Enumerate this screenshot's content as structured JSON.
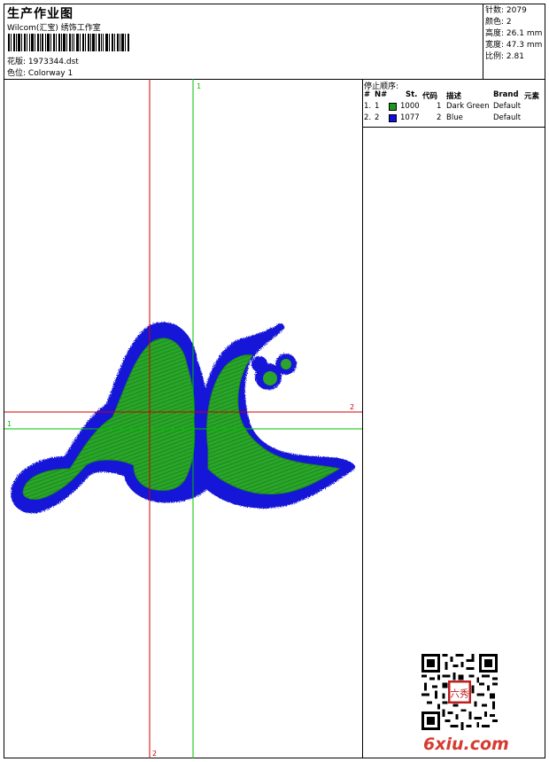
{
  "header": {
    "title": "生产作业图",
    "subtitle": "Wilcom(汇宝) 绣饰工作室",
    "file_label": "花版:",
    "file_value": "1973344.dst",
    "color_label": "色位:",
    "color_value": "Colorway 1"
  },
  "stats": {
    "stitches_label": "针数:",
    "stitches": "2079",
    "colors_label": "颜色:",
    "colors": "2",
    "height_label": "高度:",
    "height": "26.1 mm",
    "width_label": "宽度:",
    "width": "47.3 mm",
    "ratio_label": "比例:",
    "ratio": "2.81"
  },
  "guides": {
    "v_green_top": "1",
    "h_green_left": "1",
    "h_red_right": "2",
    "v_red_bottom": "2"
  },
  "stops": {
    "title": "停止顺序:",
    "headers": [
      "#",
      "N#",
      "St.",
      "代码",
      "描述",
      "Brand",
      "元素"
    ],
    "rows": [
      {
        "idx": "1.",
        "n": "1",
        "color": "#1a9a1a",
        "st": "1000",
        "code": "1",
        "desc": "Dark Green",
        "brand": "Default"
      },
      {
        "idx": "2.",
        "n": "2",
        "color": "#1010e0",
        "st": "1077",
        "code": "2",
        "desc": "Blue",
        "brand": "Default"
      }
    ]
  },
  "watermark": {
    "logo": "6xiu.com",
    "seal": "六秀"
  },
  "colors": {
    "green": "#1f9a1f",
    "blue": "#1414d8",
    "guide_red": "#d00000",
    "guide_green": "#00c000",
    "logo_red": "#d63b2f"
  }
}
